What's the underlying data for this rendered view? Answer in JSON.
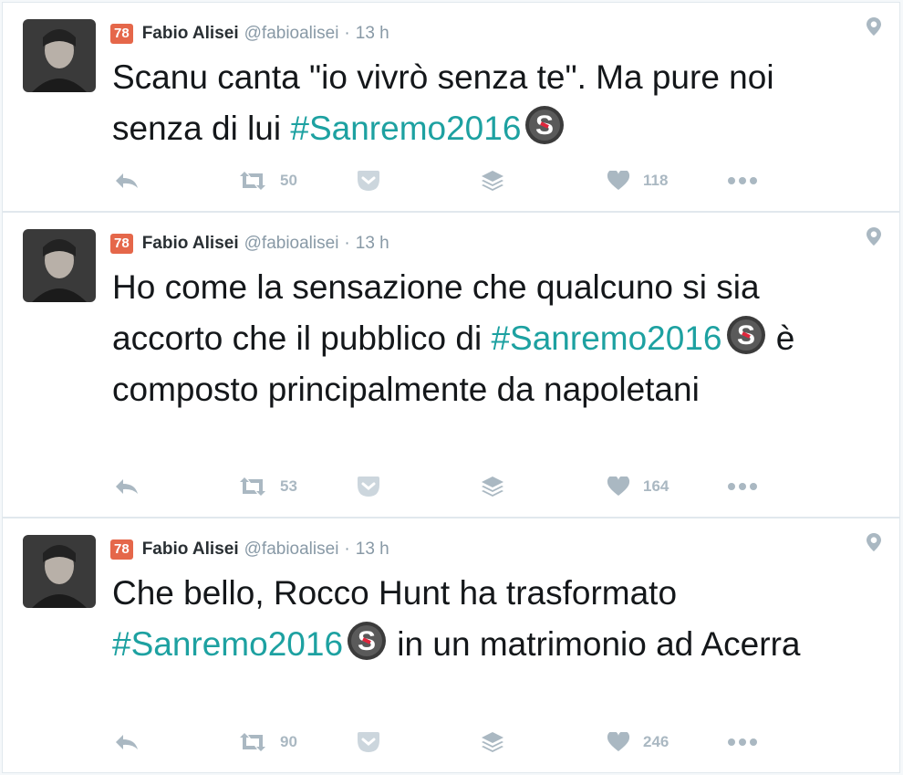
{
  "tweets": [
    {
      "badge": "78",
      "name": "Fabio Alisei",
      "handle": "@fabioalisei",
      "separator": "·",
      "time": "13 h",
      "text_before": "Scanu canta \"io vivrò senza te\". Ma pure noi senza di lui ",
      "hashtag": "#Sanremo2016",
      "text_after": "",
      "retweets": "50",
      "likes": "118"
    },
    {
      "badge": "78",
      "name": "Fabio Alisei",
      "handle": "@fabioalisei",
      "separator": "·",
      "time": "13 h",
      "text_before": "Ho come la sensazione che qualcuno si sia accorto che il pubblico di ",
      "hashtag": "#Sanremo2016",
      "text_after": " è composto principalmente da napoletani",
      "retweets": "53",
      "likes": "164"
    },
    {
      "badge": "78",
      "name": "Fabio Alisei",
      "handle": "@fabioalisei",
      "separator": "·",
      "time": "13 h",
      "text_before": "Che bello, Rocco Hunt ha trasformato ",
      "hashtag": "#Sanremo2016",
      "text_after": " in un matrimonio ad Acerra",
      "retweets": "90",
      "likes": "246"
    }
  ],
  "colors": {
    "badge": "#e5674a",
    "hashtag": "#1da1a1",
    "icon": "#aab8c2",
    "meta": "#8899a6"
  },
  "icons": [
    "reply-icon",
    "retweet-icon",
    "pocket-icon",
    "buffer-icon",
    "heart-icon",
    "more-icon",
    "location-pin-icon",
    "sanremo-hashflag-icon"
  ]
}
